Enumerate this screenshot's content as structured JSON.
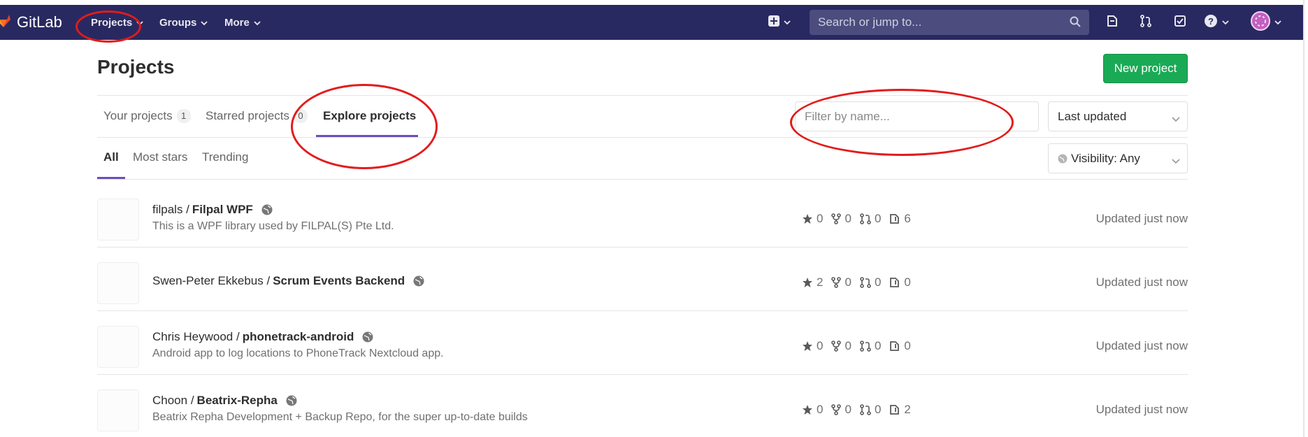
{
  "navbar": {
    "brand": "GitLab",
    "links": [
      {
        "label": "Projects"
      },
      {
        "label": "Groups"
      },
      {
        "label": "More"
      }
    ],
    "search_placeholder": "Search or jump to...",
    "icons": [
      "plus-square-icon",
      "todo-issues-icon",
      "merge-request-icon",
      "checkbox-icon",
      "help-icon",
      "user-avatar"
    ]
  },
  "page": {
    "title": "Projects",
    "new_project_label": "New project"
  },
  "tabs": [
    {
      "label": "Your projects",
      "count": "1"
    },
    {
      "label": "Starred projects",
      "count": "0"
    },
    {
      "label": "Explore projects",
      "count": null
    }
  ],
  "filter": {
    "placeholder": "Filter by name...",
    "sort_value": "Last updated",
    "visibility_value": "Visibility: Any"
  },
  "subtabs": [
    {
      "label": "All"
    },
    {
      "label": "Most stars"
    },
    {
      "label": "Trending"
    }
  ],
  "projects": [
    {
      "namespace": "filpals /",
      "name": "Filpal WPF",
      "description": "This is a WPF library used by FILPAL(S) Pte Ltd.",
      "stars": "0",
      "forks": "0",
      "merge_requests": "0",
      "issues": "6",
      "updated": "Updated just now"
    },
    {
      "namespace": "Swen-Peter Ekkebus /",
      "name": "Scrum Events Backend",
      "description": "",
      "stars": "2",
      "forks": "0",
      "merge_requests": "0",
      "issues": "0",
      "updated": "Updated just now"
    },
    {
      "namespace": "Chris Heywood /",
      "name": "phonetrack-android",
      "description": "Android app to log locations to PhoneTrack Nextcloud app.",
      "stars": "0",
      "forks": "0",
      "merge_requests": "0",
      "issues": "0",
      "updated": "Updated just now"
    },
    {
      "namespace": "Choon /",
      "name": "Beatrix-Repha",
      "description": "Beatrix Repha Development + Backup Repo, for the super up-to-date builds",
      "stars": "0",
      "forks": "0",
      "merge_requests": "0",
      "issues": "2",
      "updated": "Updated just now"
    }
  ],
  "colors": {
    "navbar": "#292961",
    "accent": "#6b4fbb",
    "success": "#1aaa55",
    "annotation": "#e31b1b"
  }
}
